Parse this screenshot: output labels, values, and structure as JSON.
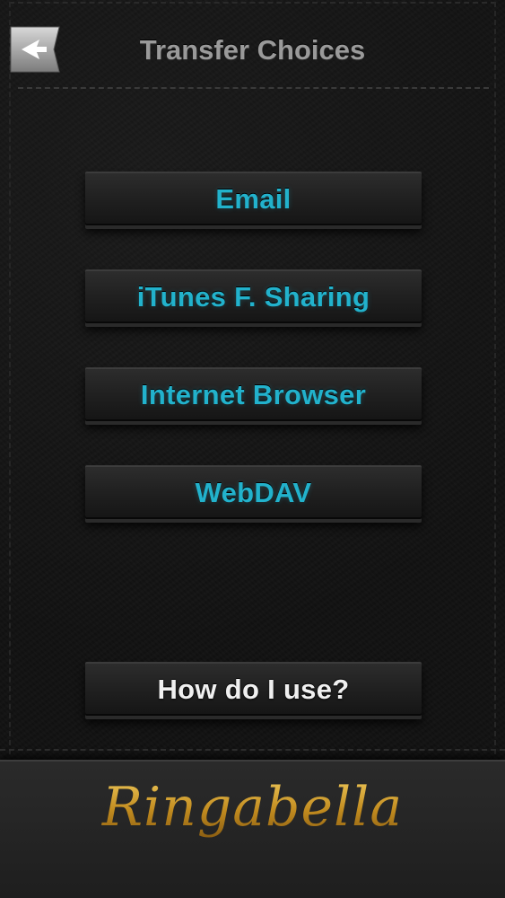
{
  "header": {
    "title": "Transfer Choices",
    "back_icon": "back-arrow-icon"
  },
  "transfer_options": [
    {
      "label": "Email"
    },
    {
      "label": "iTunes F. Sharing"
    },
    {
      "label": "Internet Browser"
    },
    {
      "label": "WebDAV"
    }
  ],
  "help": {
    "label": "How do I use?"
  },
  "footer": {
    "brand": "Ringabella"
  },
  "colors": {
    "accent_text": "#22b2cc",
    "title_text": "#9a9a9a",
    "help_text": "#f0f0f0",
    "brand_gold": "#c99a2e",
    "background": "#111111"
  }
}
